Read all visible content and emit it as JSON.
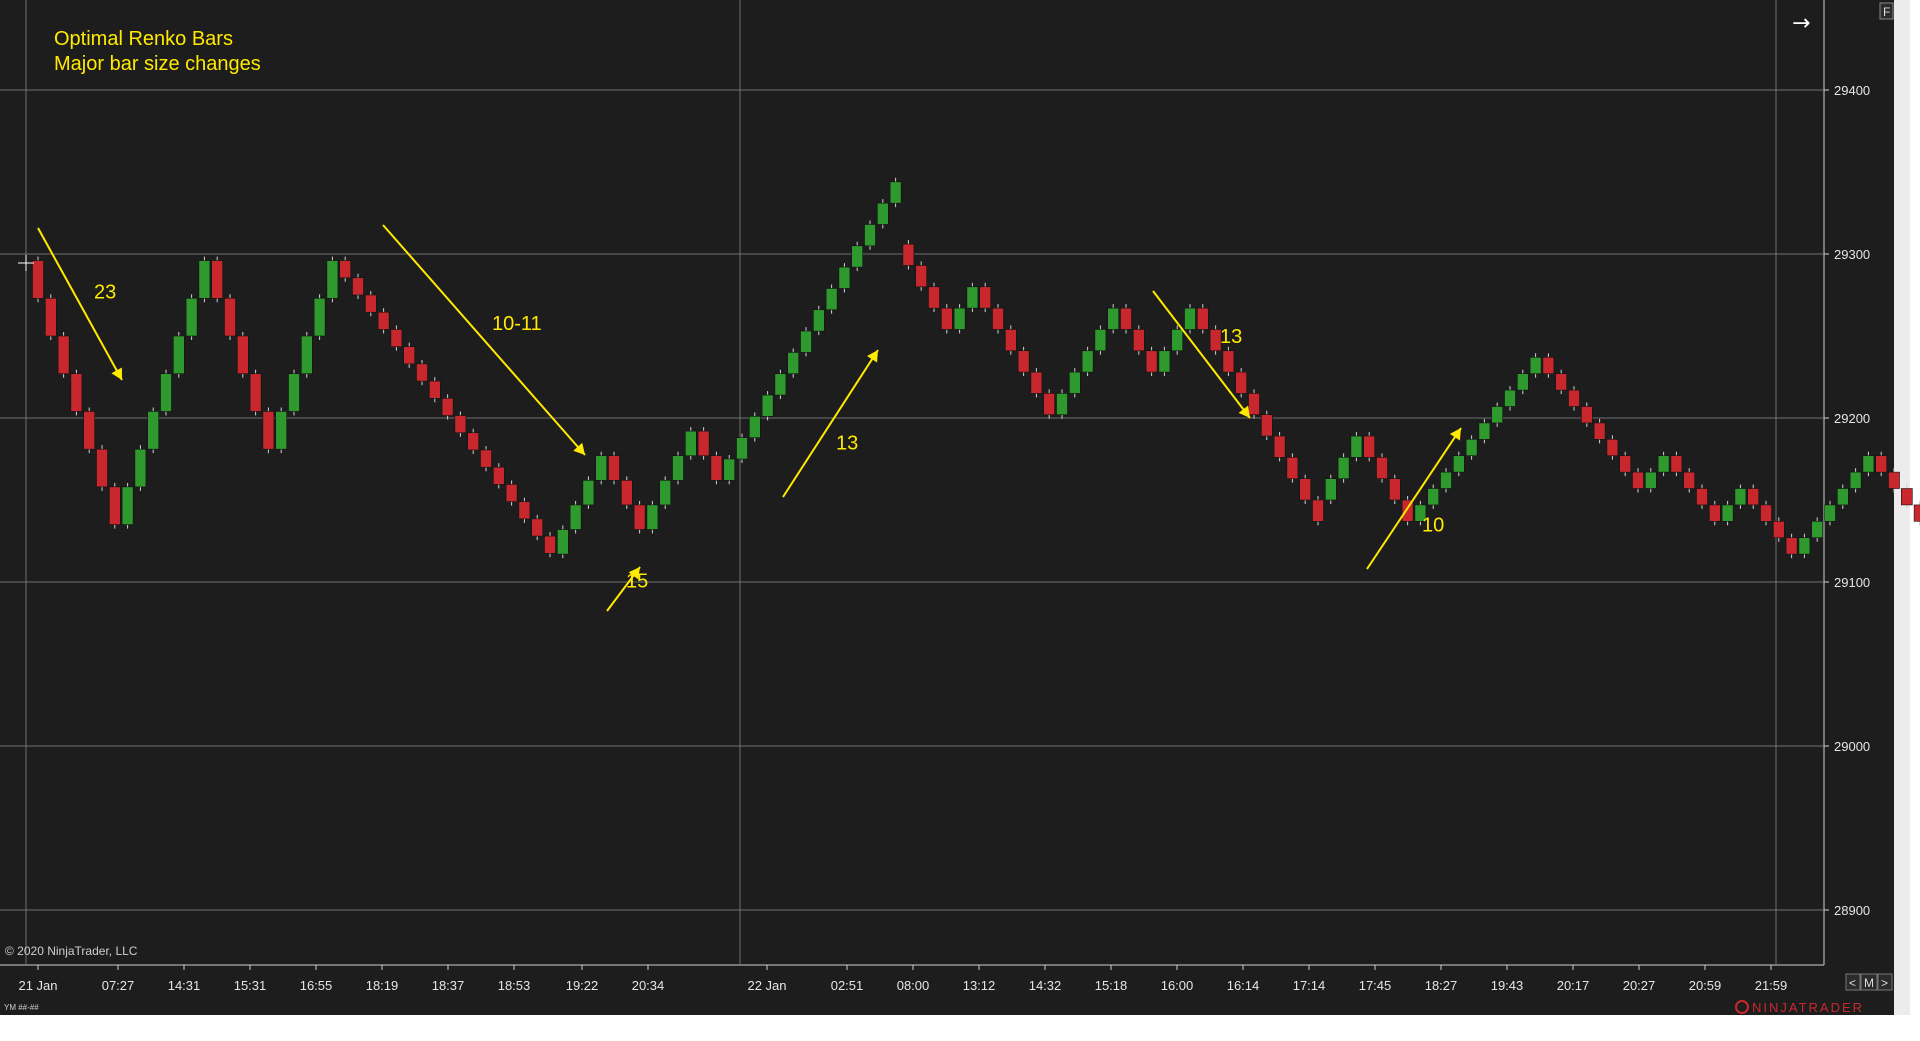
{
  "chart_data": {
    "type": "renko",
    "title": "Optimal Renko Bars",
    "subtitle": "Major bar size changes",
    "ylim": [
      28840,
      29450
    ],
    "y_ticks": [
      29400,
      29300,
      29200,
      29100,
      29000,
      28900
    ],
    "x_tick_labels": [
      "21 Jan",
      "07:27",
      "14:31",
      "15:31",
      "16:55",
      "18:19",
      "18:37",
      "18:53",
      "19:22",
      "20:34",
      "22 Jan",
      "02:51",
      "08:00",
      "13:12",
      "14:32",
      "15:18",
      "16:00",
      "16:14",
      "17:14",
      "17:45",
      "18:27",
      "19:43",
      "20:17",
      "20:27",
      "20:59",
      "21:59"
    ],
    "bar_sizes_annotated": [
      "23",
      "10-11",
      "15",
      "13",
      "13",
      "10"
    ],
    "segments": [
      {
        "dir": "down",
        "start": 29296,
        "size": 23,
        "count": 7
      },
      {
        "dir": "up",
        "start": 29135,
        "size": 23,
        "count": 7
      },
      {
        "dir": "down",
        "start": 29296,
        "size": 23,
        "count": 5
      },
      {
        "dir": "up",
        "start": 29181,
        "size": 23,
        "count": 5
      },
      {
        "dir": "down",
        "start": 29296,
        "size": 10.5,
        "count": 17
      },
      {
        "dir": "up",
        "start": 29117,
        "size": 15,
        "count": 4
      },
      {
        "dir": "down",
        "start": 29177,
        "size": 15,
        "count": 3
      },
      {
        "dir": "up",
        "start": 29132,
        "size": 15,
        "count": 4
      },
      {
        "dir": "down",
        "start": 29192,
        "size": 15,
        "count": 2
      },
      {
        "dir": "up",
        "start": 29162,
        "size": 13,
        "count": 14
      },
      {
        "dir": "down",
        "start": 29306,
        "size": 13,
        "count": 4
      },
      {
        "dir": "up",
        "start": 29254,
        "size": 13,
        "count": 2
      },
      {
        "dir": "down",
        "start": 29280,
        "size": 13,
        "count": 6
      },
      {
        "dir": "up",
        "start": 29202,
        "size": 13,
        "count": 5
      },
      {
        "dir": "down",
        "start": 29267,
        "size": 13,
        "count": 3
      },
      {
        "dir": "up",
        "start": 29228,
        "size": 13,
        "count": 3
      },
      {
        "dir": "down",
        "start": 29267,
        "size": 13,
        "count": 10
      },
      {
        "dir": "up",
        "start": 29150,
        "size": 13,
        "count": 3
      },
      {
        "dir": "down",
        "start": 29189,
        "size": 13,
        "count": 4
      },
      {
        "dir": "up",
        "start": 29137,
        "size": 10,
        "count": 10
      },
      {
        "dir": "down",
        "start": 29237,
        "size": 10,
        "count": 8
      },
      {
        "dir": "up",
        "start": 29157,
        "size": 10,
        "count": 2
      },
      {
        "dir": "down",
        "start": 29177,
        "size": 10,
        "count": 4
      },
      {
        "dir": "up",
        "start": 29137,
        "size": 10,
        "count": 2
      },
      {
        "dir": "down",
        "start": 29157,
        "size": 10,
        "count": 4
      },
      {
        "dir": "up",
        "start": 29117,
        "size": 10,
        "count": 6
      },
      {
        "dir": "down",
        "start": 29177,
        "size": 10,
        "count": 8
      },
      {
        "dir": "up",
        "start": 29097,
        "size": 10,
        "count": 2
      },
      {
        "dir": "down",
        "start": 29117,
        "size": 10,
        "count": 1
      },
      {
        "dir": "up",
        "start": 29097,
        "size": 25,
        "count": 1
      }
    ],
    "annotations": [
      {
        "text": "23",
        "price": 29277
      },
      {
        "text": "10-11",
        "price": 29258
      },
      {
        "text": "15",
        "price": 29101
      },
      {
        "text": "13",
        "price": 29185
      },
      {
        "text": "13",
        "price": 29250
      },
      {
        "text": "10",
        "price": 29135
      }
    ],
    "colors": {
      "background": "#1d1d1d",
      "up_bar": "#2e9a2e",
      "down_bar": "#c8282d",
      "grid": "#8a8a8a",
      "annotation": "#ffea00",
      "text": "#e6e6e6"
    }
  },
  "chart_ui": {
    "copyright": "© 2020 NinjaTrader, LLC",
    "instrument": "YM ##-##",
    "logo": "NINJATRADER",
    "arrow_glyph": "→",
    "f_button": "F",
    "scroll_left": "<",
    "m_button": "M",
    "scroll_right": ">"
  }
}
